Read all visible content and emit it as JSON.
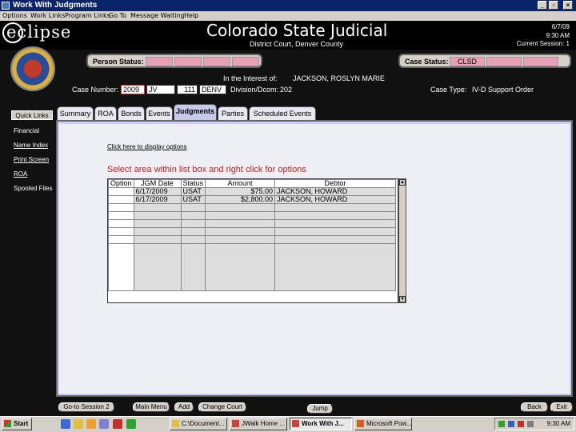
{
  "window": {
    "title": "Work With Judgments",
    "min": "_",
    "max": "▫",
    "close": "×"
  },
  "menu": [
    "Options",
    "Work Links",
    "Program Links",
    "Go To",
    "Message Waiting",
    "Help"
  ],
  "header": {
    "logo": "eclipse",
    "title": "Colorado State Judicial",
    "subtitle": "District Court, Denver County",
    "date": "6/7/09",
    "time": "9:30 AM",
    "session": "Current Session: 1"
  },
  "person_status": {
    "label": "Person Status:",
    "boxes": [
      "",
      "",
      "",
      ""
    ]
  },
  "case_status": {
    "label": "Case Status:",
    "value": "CLSD",
    "boxes": [
      "",
      ""
    ]
  },
  "case_info": {
    "interest_label": "In the Interest of:",
    "interest_value": "JACKSON, ROSLYN MARIE",
    "case_number_label": "Case Number:",
    "case_year": "2009",
    "case_type_code": "JV",
    "case_seq": "111",
    "case_county": "DENV",
    "division_label": "Division/Dcom:",
    "division_value": "202",
    "case_type_label": "Case Type:",
    "case_type_value": "IV-D Support Order"
  },
  "left_nav": {
    "quick_links": "Quick Links",
    "items": [
      "Financial",
      "Name Index",
      "Print Screen",
      "ROA",
      "Spooled Files"
    ]
  },
  "tabs": [
    "Summary",
    "ROA",
    "Bonds",
    "Events",
    "Judgments",
    "Parties",
    "Scheduled Events"
  ],
  "active_tab": "Judgments",
  "content": {
    "link": "Click here to display options",
    "instruction": "Select area within list box and right click for options"
  },
  "table": {
    "columns": [
      "Option",
      "JGM Date",
      "Status",
      "Amount",
      "Debtor"
    ],
    "rows": [
      [
        "",
        "6/17/2009",
        "USAT",
        "$75.00",
        "JACKSON, HOWARD"
      ],
      [
        "",
        "6/17/2009",
        "USAT",
        "$2,800.00",
        "JACKSON, HOWARD"
      ],
      [
        "",
        "",
        "",
        "",
        ""
      ],
      [
        "",
        "",
        "",
        "",
        ""
      ],
      [
        "",
        "",
        "",
        "",
        ""
      ],
      [
        "",
        "",
        "",
        "",
        ""
      ],
      [
        "",
        "",
        "",
        "",
        ""
      ],
      [
        "",
        "",
        "",
        "",
        ""
      ]
    ]
  },
  "bottom_buttons": {
    "goto_session": "Go-to Session 2",
    "main_menu": "Main Menu",
    "add": "Add",
    "change_court": "Change Court",
    "jump": "Jump",
    "back": "Back",
    "exit": "Exit"
  },
  "taskbar": {
    "start": "Start",
    "tasks": [
      "C:\\Document...",
      "JWalk Home ...",
      "Work With J...",
      "Microsoft Pow..."
    ],
    "active_task": "Work With J...",
    "clock": "9:30 AM"
  }
}
